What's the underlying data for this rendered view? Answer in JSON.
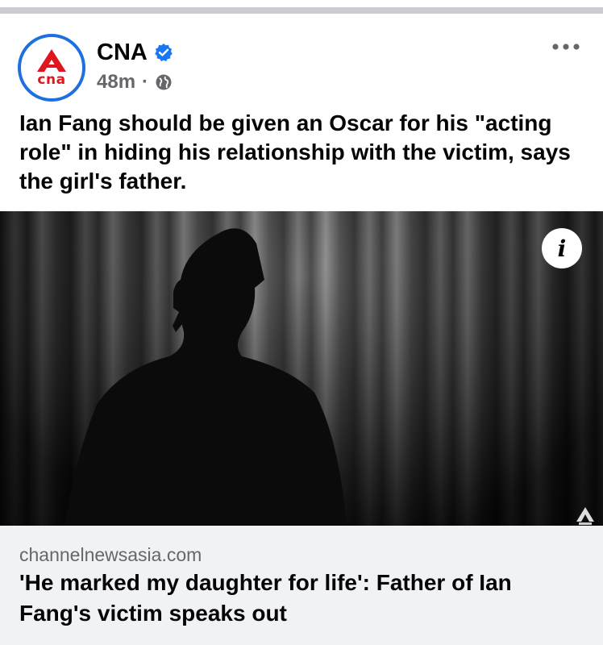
{
  "post": {
    "page_name": "CNA",
    "avatar_text": "cna",
    "time": "48m",
    "separator": "·",
    "caption": "Ian Fang should be given an Oscar for his \"acting role\" in hiding his relationship with the victim, says the girl's father.",
    "verified": true,
    "audience_icon": "globe-icon",
    "more_icon": "more-horizontal-icon"
  },
  "media": {
    "info_icon_text": "i"
  },
  "link_preview": {
    "domain": "channelnewsasia.com",
    "title": "'He marked my daughter for life': Father of Ian Fang's victim speaks out"
  },
  "colors": {
    "brand_red": "#e0161e",
    "verified_blue": "#1877f2",
    "avatar_ring": "#1e6fe0",
    "meta_gray": "#65676b",
    "preview_bg": "#f0f2f5"
  }
}
